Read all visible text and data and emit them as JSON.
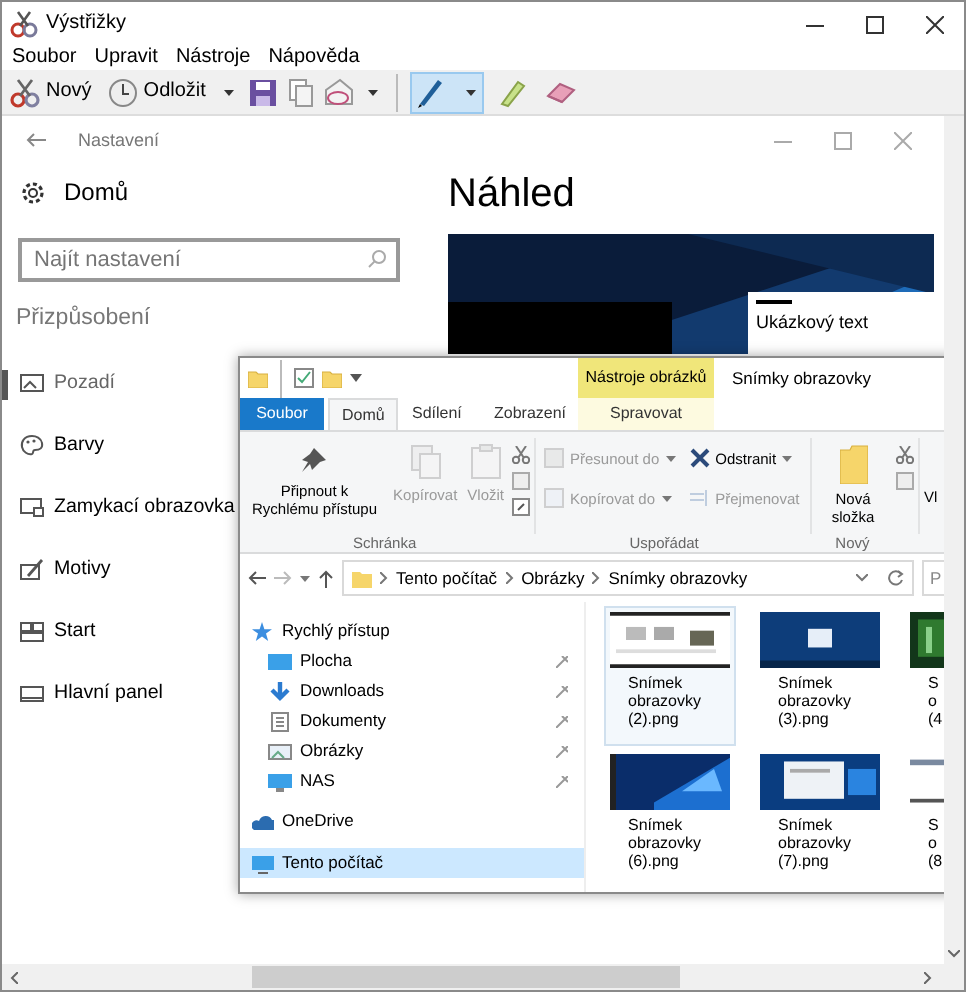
{
  "window": {
    "title": "Výstřižky"
  },
  "menu": [
    "Soubor",
    "Upravit",
    "Nástroje",
    "Nápověda"
  ],
  "toolbar": [
    {
      "kind": "new",
      "label": "Nový"
    },
    {
      "kind": "delay",
      "label": "Odložit",
      "dropdown": true
    },
    {
      "kind": "save"
    },
    {
      "kind": "copy"
    },
    {
      "kind": "send",
      "dropdown": true
    }
  ],
  "tools": [
    {
      "kind": "pen",
      "selected": true,
      "dropdown": true
    },
    {
      "kind": "highlighter",
      "selected": false
    },
    {
      "kind": "eraser",
      "selected": false
    }
  ],
  "capture": {
    "settings": {
      "title": "Nastavení",
      "home": "Domů",
      "search": {
        "placeholder": "Najít nastavení"
      },
      "section": "Přizpůsobení",
      "items": [
        {
          "label": "Pozadí",
          "selected": true
        },
        {
          "label": "Barvy",
          "selected": false
        },
        {
          "label": "Zamykací obrazovka",
          "selected": false
        },
        {
          "label": "Motivy",
          "selected": false
        },
        {
          "label": "Start",
          "selected": false
        },
        {
          "label": "Hlavní panel",
          "selected": false
        }
      ],
      "preview_title": "Náhled",
      "preview_sample": "Ukázkový text"
    },
    "explorer": {
      "title": "Snímky obrazovky",
      "context_tab": "Nástroje obrázků",
      "tabs": [
        {
          "label": "Soubor",
          "kind": "file",
          "selected": false
        },
        {
          "label": "Domů",
          "kind": "tab",
          "selected": true
        },
        {
          "label": "Sdílení",
          "kind": "tab",
          "selected": false
        },
        {
          "label": "Zobrazení",
          "kind": "tab",
          "selected": false
        },
        {
          "label": "Spravovat",
          "kind": "context",
          "selected": false
        }
      ],
      "ribbon": [
        {
          "label": "Schránka",
          "commands": [
            {
              "kind": "pin",
              "label": "Připnout k Rychlému přístupu",
              "disabled": false
            },
            {
              "kind": "copy",
              "label": "Kopírovat",
              "disabled": true
            },
            {
              "kind": "paste",
              "label": "Vložit",
              "disabled": true
            },
            {
              "kind": "small-tools"
            }
          ]
        },
        {
          "label": "Uspořádat",
          "commands": [
            {
              "kind": "move",
              "label": "Přesunout do",
              "disabled": true
            },
            {
              "kind": "copyto",
              "label": "Kopírovat do",
              "disabled": true
            },
            {
              "kind": "delete",
              "label": "Odstranit",
              "disabled": false
            },
            {
              "kind": "rename",
              "label": "Přejmenovat",
              "disabled": true
            }
          ]
        },
        {
          "label": "Nový",
          "commands": [
            {
              "kind": "newfolder",
              "label": "Nová složka",
              "disabled": false
            },
            {
              "kind": "small-tools"
            }
          ]
        },
        {
          "commands": [
            {
              "kind": "cut-label",
              "label": "Vl"
            }
          ]
        }
      ],
      "address": {
        "path": [
          "Tento počítač",
          "Obrázky",
          "Snímky obrazovky"
        ],
        "search_placeholder": "P"
      },
      "nav": [
        {
          "label": "Rychlý přístup",
          "selected": false,
          "children": [
            {
              "label": "Plocha",
              "selected": false,
              "pinned": true
            },
            {
              "label": "Downloads",
              "selected": false,
              "pinned": true
            },
            {
              "label": "Dokumenty",
              "selected": false,
              "pinned": true
            },
            {
              "label": "Obrázky",
              "selected": false,
              "pinned": true
            },
            {
              "label": "NAS",
              "selected": false,
              "pinned": true
            }
          ]
        },
        {
          "label": "OneDrive",
          "selected": false
        },
        {
          "label": "Tento počítač",
          "selected": true
        }
      ],
      "files": [
        {
          "label": "Snímek\nobrazovky\n(2).png",
          "selected": true
        },
        {
          "label": "Snímek\nobrazovky\n(3).png",
          "selected": false
        },
        {
          "label": "S\no\n(4",
          "selected": false
        },
        {
          "label": "Snímek\nobrazovky\n(6).png",
          "selected": false
        },
        {
          "label": "Snímek\nobrazovky\n(7).png",
          "selected": false
        },
        {
          "label": "S\no\n(8",
          "selected": false
        }
      ]
    }
  }
}
